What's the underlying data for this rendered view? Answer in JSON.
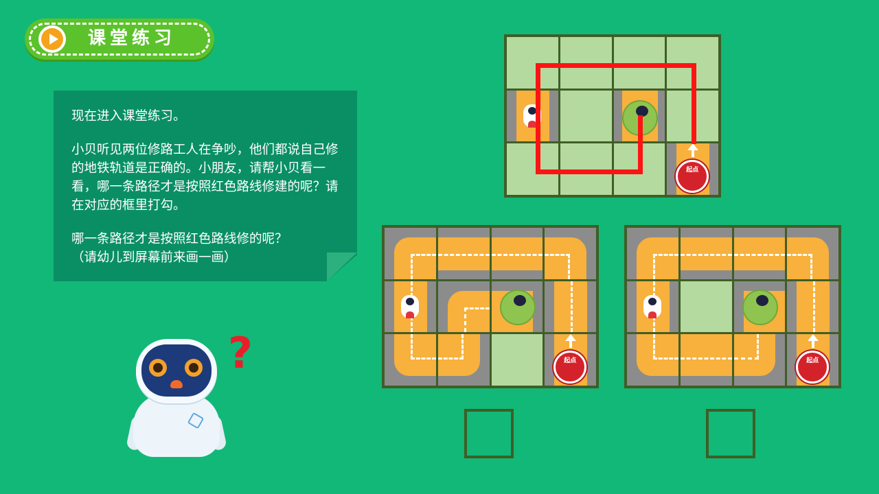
{
  "header": {
    "title": "课堂练习",
    "icon": "play-icon",
    "accent": "#5cc22c"
  },
  "instructions": {
    "line1": "现在进入课堂练习。",
    "para2": "小贝听见两位修路工人在争吵，他们都说自己修的地铁轨道是正确的。小朋友，请帮小贝看一看，哪一条路径才是按照红色路线修建的呢？请在对应的框里打勾。",
    "para3_line1": "哪一条路径才是按照红色路线修的呢？",
    "para3_line2": "（请幼儿到屏幕前来画一画）"
  },
  "start_marker": {
    "label": "起点"
  },
  "colors": {
    "background": "#12b877",
    "route": "#ff1414",
    "road": "#f7b13c",
    "grid_border": "#3f5e26"
  }
}
